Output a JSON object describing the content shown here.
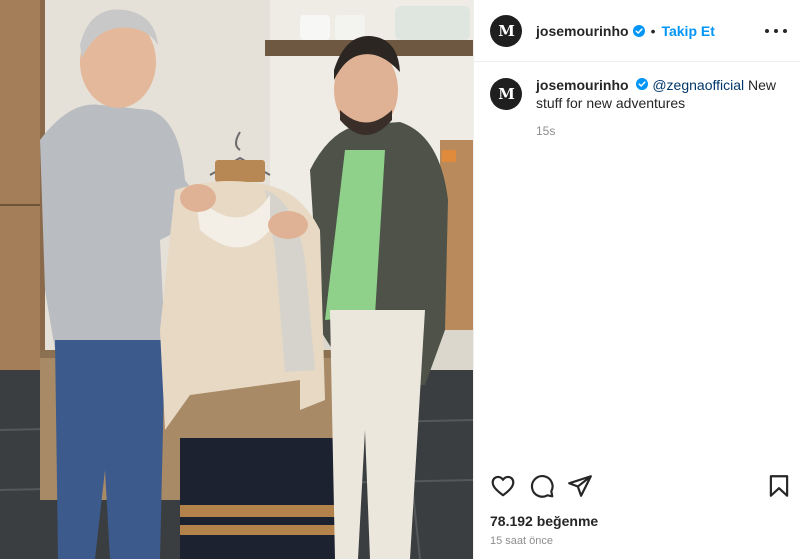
{
  "post": {
    "username": "josemourinho",
    "avatar_letter": "M",
    "follow_label": "Takip Et",
    "separator": "•",
    "caption": {
      "mention": "@zegnaofficial",
      "text": " New stuff for new adventures",
      "time": "15s"
    },
    "likes": "78.192 beğenme",
    "time_ago": "15 saat önce"
  },
  "icons": {
    "verified": "verified-badge-icon",
    "more": "more-options-icon",
    "like": "heart-icon",
    "comment": "comment-icon",
    "share": "send-icon",
    "save": "bookmark-icon"
  },
  "colors": {
    "accent": "#0095f6",
    "mention": "#00376b",
    "muted": "#8e8e8e",
    "text": "#262626"
  }
}
